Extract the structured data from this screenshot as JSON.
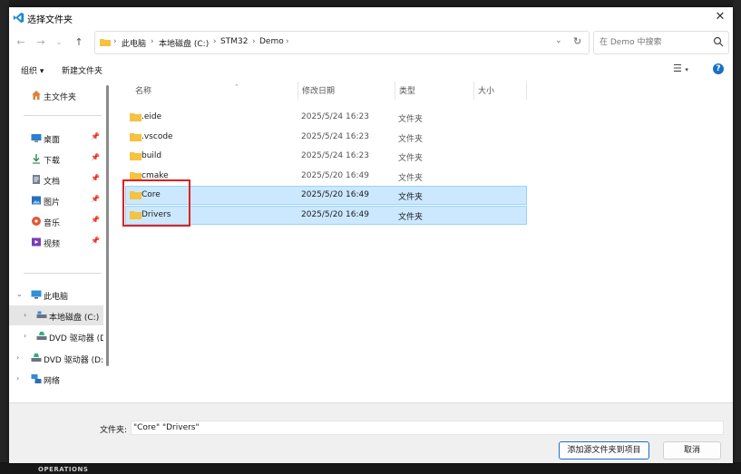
{
  "window": {
    "title": "选择文件夹"
  },
  "address": {
    "crumbs": [
      "此电脑",
      "本地磁盘 (C:)",
      "STM32",
      "Demo"
    ]
  },
  "search": {
    "placeholder": "在 Demo 中搜索"
  },
  "toolbar": {
    "organize": "组织 ▾",
    "new_folder": "新建文件夹"
  },
  "sidebar": {
    "home": "主文件夹",
    "quick": [
      {
        "label": "桌面",
        "icon": "desktop-icon"
      },
      {
        "label": "下载",
        "icon": "download-icon"
      },
      {
        "label": "文档",
        "icon": "document-icon"
      },
      {
        "label": "图片",
        "icon": "pictures-icon"
      },
      {
        "label": "音乐",
        "icon": "music-icon"
      },
      {
        "label": "视频",
        "icon": "video-icon"
      }
    ],
    "this_pc": "此电脑",
    "drives": [
      "本地磁盘 (C:)",
      "DVD 驱动器 (D",
      "DVD 驱动器 (D:"
    ],
    "network": "网络"
  },
  "columns": {
    "name": "名称",
    "modified": "修改日期",
    "type": "类型",
    "size": "大小"
  },
  "files": [
    {
      "name": ".eide",
      "modified": "2025/5/24 16:23",
      "type": "文件夹",
      "selected": false
    },
    {
      "name": ".vscode",
      "modified": "2025/5/24 16:23",
      "type": "文件夹",
      "selected": false
    },
    {
      "name": "build",
      "modified": "2025/5/24 16:23",
      "type": "文件夹",
      "selected": false
    },
    {
      "name": "cmake",
      "modified": "2025/5/20 16:49",
      "type": "文件夹",
      "selected": false
    },
    {
      "name": "Core",
      "modified": "2025/5/20 16:49",
      "type": "文件夹",
      "selected": true
    },
    {
      "name": "Drivers",
      "modified": "2025/5/20 16:49",
      "type": "文件夹",
      "selected": true
    }
  ],
  "footer": {
    "filename_label": "文件夹:",
    "filename_value": "\"Core\" \"Drivers\"",
    "confirm": "添加源文件夹到项目",
    "cancel": "取消"
  },
  "background": {
    "panel_text": "OPERATIONS"
  },
  "colors": {
    "selection": "#cce8ff",
    "selection_border": "#99d1ff",
    "annotation": "#e0201f",
    "accent": "#1a6fc7",
    "folder": "#f5c242"
  }
}
